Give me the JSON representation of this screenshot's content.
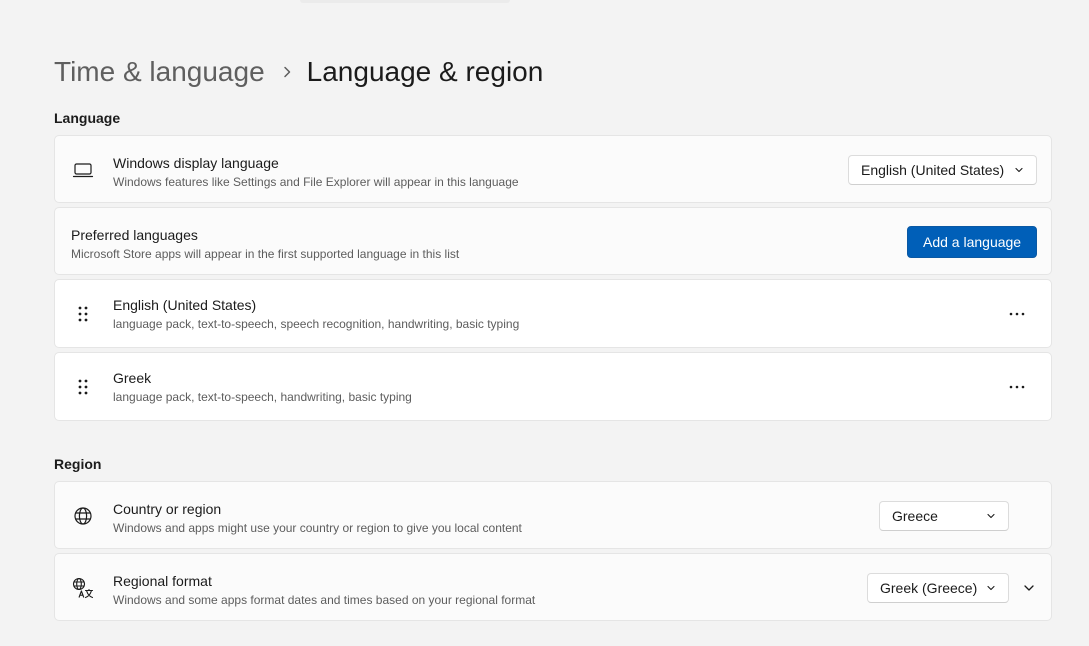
{
  "breadcrumb": {
    "parent": "Time & language",
    "current": "Language & region"
  },
  "language_section": {
    "title": "Language",
    "display_language": {
      "title": "Windows display language",
      "subtitle": "Windows features like Settings and File Explorer will appear in this language",
      "value": "English (United States)",
      "icon": "laptop-icon"
    },
    "preferred": {
      "title": "Preferred languages",
      "subtitle": "Microsoft Store apps will appear in the first supported language in this list",
      "button": "Add a language"
    },
    "languages": [
      {
        "name": "English (United States)",
        "features": "language pack, text-to-speech, speech recognition, handwriting, basic typing"
      },
      {
        "name": "Greek",
        "features": "language pack, text-to-speech, handwriting, basic typing"
      }
    ]
  },
  "region_section": {
    "title": "Region",
    "country": {
      "title": "Country or region",
      "subtitle": "Windows and apps might use your country or region to give you local content",
      "value": "Greece",
      "icon": "globe-icon"
    },
    "format": {
      "title": "Regional format",
      "subtitle": "Windows and some apps format dates and times based on your regional format",
      "value": "Greek (Greece)",
      "icon": "language-format-icon"
    }
  },
  "colors": {
    "accent": "#005fb8",
    "background": "#f3f3f3",
    "card": "#fbfbfb"
  }
}
